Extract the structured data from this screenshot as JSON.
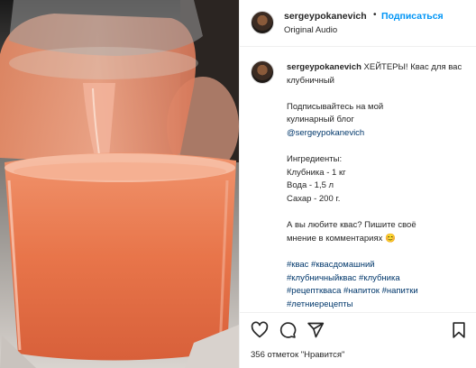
{
  "post": {
    "username": "sergeypokanevich",
    "follow_label": "Подписаться",
    "dot": "•",
    "subtitle": "Original Audio"
  },
  "caption": {
    "username": "sergeypokanevich",
    "line1": "ХЕЙТЕРЫ! Квас для вас клубничный",
    "p2_line1": "Подписывайтесь на мой",
    "p2_line2": "кулинарный блог",
    "p2_line3": "@sergeypokanevich",
    "ing_title": "Ингредиенты:",
    "ing1": "Клубника - 1 кг",
    "ing2": "Вода - 1,5 л",
    "ing3": "Сахар - 200 г.",
    "q_line1": "А вы любите квас? Пишите своё",
    "q_line2": "мнение в комментариях 😊",
    "tags_line1": "#квас #квасдомашний",
    "tags_line2": "#клубничныйквас #клубника",
    "tags_line3": "#рецепткваса #напиток #напитки",
    "tags_line4": "#летниерецепты"
  },
  "actions": {
    "like_icon": "heart-icon",
    "comment_icon": "comment-icon",
    "share_icon": "share-icon",
    "save_icon": "bookmark-icon"
  },
  "likes_text": "356 отметок \"Нравится\""
}
